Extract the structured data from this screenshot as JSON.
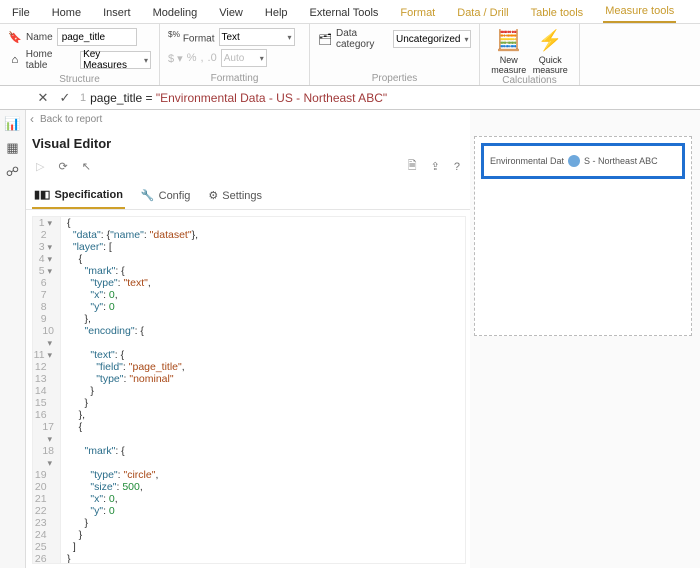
{
  "tabs": {
    "file": "File",
    "home": "Home",
    "insert": "Insert",
    "modeling": "Modeling",
    "view": "View",
    "help": "Help",
    "external": "External Tools",
    "format": "Format",
    "datadrill": "Data / Drill",
    "tabletools": "Table tools",
    "measuretools": "Measure tools"
  },
  "structure": {
    "name_label": "Name",
    "name_value": "page_title",
    "home_label": "Home table",
    "home_value": "Key Measures",
    "title": "Structure"
  },
  "formatting": {
    "format_label": "Format",
    "format_value": "Text",
    "auto": "Auto",
    "title": "Formatting"
  },
  "properties": {
    "datacat_label": "Data category",
    "datacat_value": "Uncategorized",
    "title": "Properties"
  },
  "calculations": {
    "new": "New measure",
    "quick": "Quick measure",
    "title": "Calculations"
  },
  "formula": {
    "line_no": "1",
    "measure": "page_title = ",
    "string": "\"Environmental Data - US - Northeast ABC\""
  },
  "back": "Back to report",
  "visual_editor": {
    "title": "Visual Editor",
    "tabs": {
      "spec": "Specification",
      "config": "Config",
      "settings": "Settings"
    }
  },
  "code": [
    {
      "n": "1",
      "f": "-",
      "t": [
        {
          "c": "tok-brace",
          "v": "{"
        }
      ]
    },
    {
      "n": "2",
      "f": "",
      "t": [
        {
          "c": "",
          "v": "  "
        },
        {
          "c": "tok-key",
          "v": "\"data\""
        },
        {
          "c": "",
          "v": ": {"
        },
        {
          "c": "tok-key",
          "v": "\"name\""
        },
        {
          "c": "",
          "v": ": "
        },
        {
          "c": "tok-str",
          "v": "\"dataset\""
        },
        {
          "c": "",
          "v": "},"
        }
      ]
    },
    {
      "n": "3",
      "f": "-",
      "t": [
        {
          "c": "",
          "v": "  "
        },
        {
          "c": "tok-key",
          "v": "\"layer\""
        },
        {
          "c": "",
          "v": ": ["
        }
      ]
    },
    {
      "n": "4",
      "f": "-",
      "t": [
        {
          "c": "",
          "v": "    {"
        }
      ]
    },
    {
      "n": "5",
      "f": "-",
      "t": [
        {
          "c": "",
          "v": "      "
        },
        {
          "c": "tok-key",
          "v": "\"mark\""
        },
        {
          "c": "",
          "v": ": {"
        }
      ]
    },
    {
      "n": "6",
      "f": "",
      "t": [
        {
          "c": "",
          "v": "        "
        },
        {
          "c": "tok-key",
          "v": "\"type\""
        },
        {
          "c": "",
          "v": ": "
        },
        {
          "c": "tok-str",
          "v": "\"text\""
        },
        {
          "c": "",
          "v": ","
        }
      ]
    },
    {
      "n": "7",
      "f": "",
      "t": [
        {
          "c": "",
          "v": "        "
        },
        {
          "c": "tok-key",
          "v": "\"x\""
        },
        {
          "c": "",
          "v": ": "
        },
        {
          "c": "tok-num",
          "v": "0"
        },
        {
          "c": "",
          "v": ","
        }
      ]
    },
    {
      "n": "8",
      "f": "",
      "t": [
        {
          "c": "",
          "v": "        "
        },
        {
          "c": "tok-key",
          "v": "\"y\""
        },
        {
          "c": "",
          "v": ": "
        },
        {
          "c": "tok-num",
          "v": "0"
        }
      ]
    },
    {
      "n": "9",
      "f": "",
      "t": [
        {
          "c": "",
          "v": "      },"
        }
      ]
    },
    {
      "n": "10",
      "f": "-",
      "t": [
        {
          "c": "",
          "v": "      "
        },
        {
          "c": "tok-key",
          "v": "\"encoding\""
        },
        {
          "c": "",
          "v": ": {"
        }
      ]
    },
    {
      "n": "11",
      "f": "-",
      "t": [
        {
          "c": "",
          "v": "        "
        },
        {
          "c": "tok-key",
          "v": "\"text\""
        },
        {
          "c": "",
          "v": ": {"
        }
      ]
    },
    {
      "n": "12",
      "f": "",
      "t": [
        {
          "c": "",
          "v": "          "
        },
        {
          "c": "tok-key",
          "v": "\"field\""
        },
        {
          "c": "",
          "v": ": "
        },
        {
          "c": "tok-str",
          "v": "\"page_title\""
        },
        {
          "c": "",
          "v": ","
        }
      ]
    },
    {
      "n": "13",
      "f": "",
      "t": [
        {
          "c": "",
          "v": "          "
        },
        {
          "c": "tok-key",
          "v": "\"type\""
        },
        {
          "c": "",
          "v": ": "
        },
        {
          "c": "tok-str",
          "v": "\"nominal\""
        }
      ]
    },
    {
      "n": "14",
      "f": "",
      "t": [
        {
          "c": "",
          "v": "        }"
        }
      ]
    },
    {
      "n": "15",
      "f": "",
      "t": [
        {
          "c": "",
          "v": "      }"
        }
      ]
    },
    {
      "n": "16",
      "f": "",
      "t": [
        {
          "c": "",
          "v": "    },"
        }
      ]
    },
    {
      "n": "17",
      "f": "-",
      "t": [
        {
          "c": "",
          "v": "    {"
        }
      ]
    },
    {
      "n": "18",
      "f": "-",
      "t": [
        {
          "c": "",
          "v": "      "
        },
        {
          "c": "tok-key",
          "v": "\"mark\""
        },
        {
          "c": "",
          "v": ": {"
        }
      ]
    },
    {
      "n": "19",
      "f": "",
      "t": [
        {
          "c": "",
          "v": "        "
        },
        {
          "c": "tok-key",
          "v": "\"type\""
        },
        {
          "c": "",
          "v": ": "
        },
        {
          "c": "tok-str",
          "v": "\"circle\""
        },
        {
          "c": "",
          "v": ","
        }
      ]
    },
    {
      "n": "20",
      "f": "",
      "t": [
        {
          "c": "",
          "v": "        "
        },
        {
          "c": "tok-key",
          "v": "\"size\""
        },
        {
          "c": "",
          "v": ": "
        },
        {
          "c": "tok-num",
          "v": "500"
        },
        {
          "c": "",
          "v": ","
        }
      ]
    },
    {
      "n": "21",
      "f": "",
      "t": [
        {
          "c": "",
          "v": "        "
        },
        {
          "c": "tok-key",
          "v": "\"x\""
        },
        {
          "c": "",
          "v": ": "
        },
        {
          "c": "tok-num",
          "v": "0"
        },
        {
          "c": "",
          "v": ","
        }
      ]
    },
    {
      "n": "22",
      "f": "",
      "t": [
        {
          "c": "",
          "v": "        "
        },
        {
          "c": "tok-key",
          "v": "\"y\""
        },
        {
          "c": "",
          "v": ": "
        },
        {
          "c": "tok-num",
          "v": "0"
        }
      ]
    },
    {
      "n": "23",
      "f": "",
      "t": [
        {
          "c": "",
          "v": "      }"
        }
      ]
    },
    {
      "n": "24",
      "f": "",
      "t": [
        {
          "c": "",
          "v": "    }"
        }
      ]
    },
    {
      "n": "25",
      "f": "",
      "t": [
        {
          "c": "",
          "v": "  ]"
        }
      ]
    },
    {
      "n": "26",
      "f": "",
      "t": [
        {
          "c": "tok-brace",
          "v": "}"
        }
      ]
    }
  ],
  "preview": {
    "title_left": "Environmental Dat",
    "title_right": "S - Northeast ABC"
  }
}
